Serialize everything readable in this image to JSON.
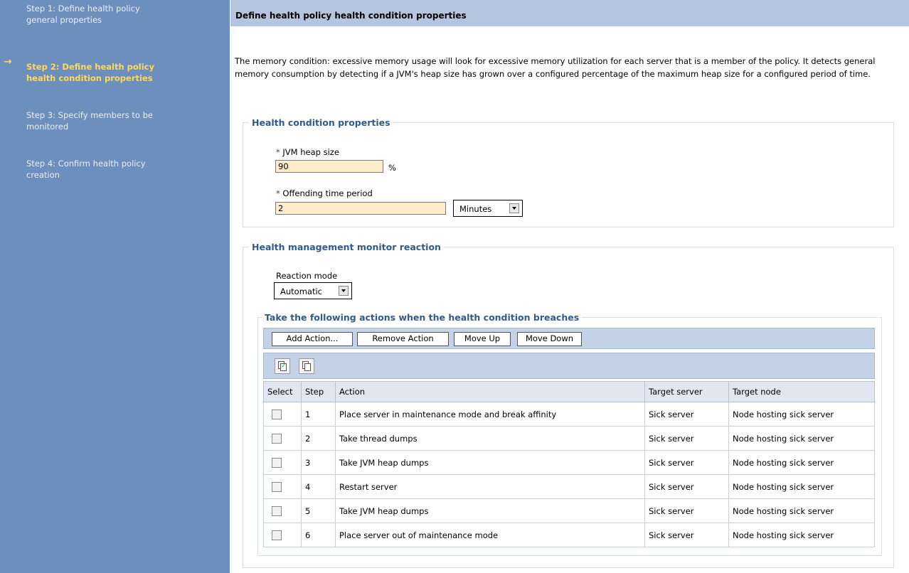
{
  "wizard": {
    "steps": [
      {
        "label": "Step 1: Define health policy general properties"
      },
      {
        "label": "Step 2: Define health policy health condition properties"
      },
      {
        "label": "Step 3: Specify members to be monitored"
      },
      {
        "label": "Step 4: Confirm health policy creation"
      }
    ],
    "current_step_marker": "→",
    "current_color": "#ffd95a"
  },
  "page": {
    "title": "Define health policy health condition properties",
    "description": "The memory condition: excessive memory usage will look for excessive memory utilization for each server that is a member of the policy. It detects general memory consumption by detecting if a JVM's heap size has grown over a configured percentage of the maximum heap size for a configured period of time."
  },
  "health_condition": {
    "legend": "Health condition properties",
    "required_marker": "*",
    "heap_label": "JVM heap size",
    "heap_value": "90",
    "heap_unit": "%",
    "period_label": "Offending time period",
    "period_value": "2",
    "period_unit": "Minutes"
  },
  "monitor_reaction": {
    "legend": "Health management monitor reaction",
    "mode_label": "Reaction mode",
    "mode_value": "Automatic"
  },
  "actions": {
    "legend": "Take the following actions when the health condition breaches",
    "buttons": {
      "add": "Add Action...",
      "remove": "Remove Action",
      "up": "Move Up",
      "down": "Move Down"
    },
    "icons": [
      "select-all-icon",
      "deselect-all-icon"
    ],
    "columns": [
      "Select",
      "Step",
      "Action",
      "Target server",
      "Target node"
    ],
    "rows": [
      {
        "step": "1",
        "action": "Place server in maintenance mode and break affinity",
        "server": "Sick server",
        "node": "Node hosting sick server"
      },
      {
        "step": "2",
        "action": "Take thread dumps",
        "server": "Sick server",
        "node": "Node hosting sick server"
      },
      {
        "step": "3",
        "action": "Take JVM heap dumps",
        "server": "Sick server",
        "node": "Node hosting sick server"
      },
      {
        "step": "4",
        "action": "Restart server",
        "server": "Sick server",
        "node": "Node hosting sick server"
      },
      {
        "step": "5",
        "action": "Take JVM heap dumps",
        "server": "Sick server",
        "node": "Node hosting sick server"
      },
      {
        "step": "6",
        "action": "Place server out of maintenance mode",
        "server": "Sick server",
        "node": "Node hosting sick server"
      }
    ]
  }
}
